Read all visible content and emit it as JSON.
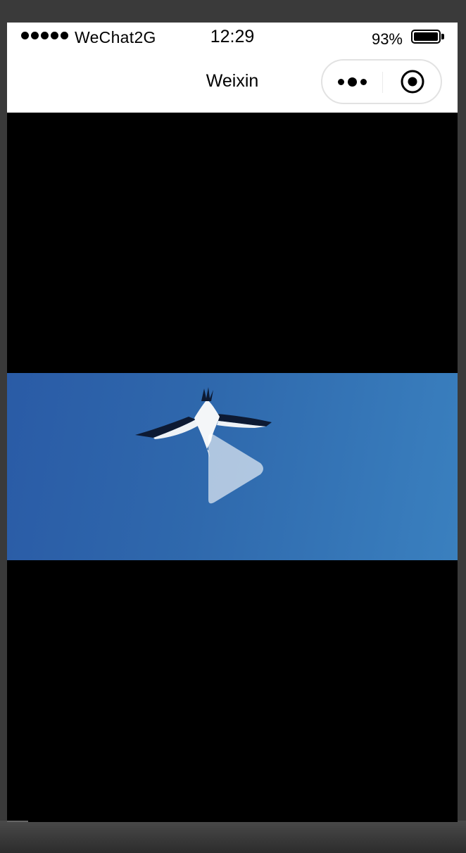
{
  "status_bar": {
    "carrier": "WeChat2G",
    "time": "12:29",
    "battery": "93%"
  },
  "nav_bar": {
    "title": "Weixin"
  },
  "video": {
    "icons": [
      "play-icon"
    ],
    "accent_color": "#2f69ad"
  }
}
